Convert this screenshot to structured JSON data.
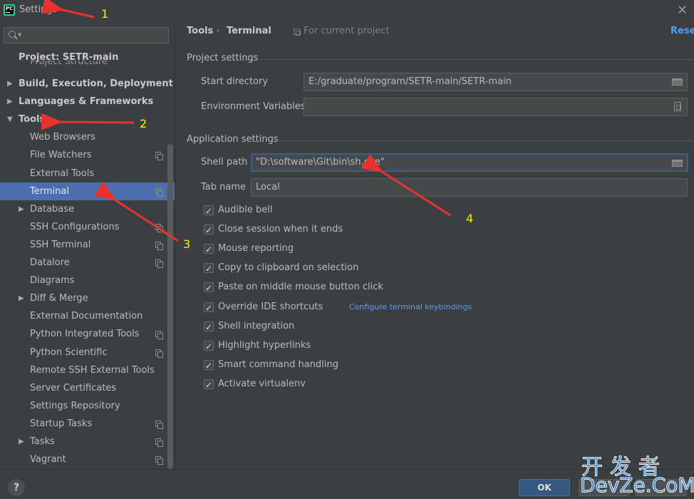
{
  "window": {
    "title": "Settings",
    "logo_text": "PC"
  },
  "sidebar": {
    "search_placeholder": "",
    "group_header": "Project: SETR-main",
    "clipped_item": "Project Structure",
    "items": [
      {
        "label": "Build, Execution, Deployment",
        "level": 0,
        "arrow": "▶",
        "bold": true,
        "project_scope": false
      },
      {
        "label": "Languages & Frameworks",
        "level": 0,
        "arrow": "▶",
        "bold": true,
        "project_scope": false
      },
      {
        "label": "Tools",
        "level": 0,
        "arrow": "▼",
        "bold": true,
        "project_scope": false
      },
      {
        "label": "Web Browsers",
        "level": 1,
        "arrow": "",
        "bold": false,
        "project_scope": false
      },
      {
        "label": "File Watchers",
        "level": 1,
        "arrow": "",
        "bold": false,
        "project_scope": true
      },
      {
        "label": "External Tools",
        "level": 1,
        "arrow": "",
        "bold": false,
        "project_scope": false
      },
      {
        "label": "Terminal",
        "level": 1,
        "arrow": "",
        "bold": false,
        "project_scope": true,
        "selected": true
      },
      {
        "label": "Database",
        "level": 1,
        "arrow": "▶",
        "bold": false,
        "project_scope": false
      },
      {
        "label": "SSH Configurations",
        "level": 1,
        "arrow": "",
        "bold": false,
        "project_scope": true
      },
      {
        "label": "SSH Terminal",
        "level": 1,
        "arrow": "",
        "bold": false,
        "project_scope": true
      },
      {
        "label": "Datalore",
        "level": 1,
        "arrow": "",
        "bold": false,
        "project_scope": true
      },
      {
        "label": "Diagrams",
        "level": 1,
        "arrow": "",
        "bold": false,
        "project_scope": false
      },
      {
        "label": "Diff & Merge",
        "level": 1,
        "arrow": "▶",
        "bold": false,
        "project_scope": false
      },
      {
        "label": "External Documentation",
        "level": 1,
        "arrow": "",
        "bold": false,
        "project_scope": false
      },
      {
        "label": "Python Integrated Tools",
        "level": 1,
        "arrow": "",
        "bold": false,
        "project_scope": true
      },
      {
        "label": "Python Scientific",
        "level": 1,
        "arrow": "",
        "bold": false,
        "project_scope": true
      },
      {
        "label": "Remote SSH External Tools",
        "level": 1,
        "arrow": "",
        "bold": false,
        "project_scope": false
      },
      {
        "label": "Server Certificates",
        "level": 1,
        "arrow": "",
        "bold": false,
        "project_scope": false
      },
      {
        "label": "Settings Repository",
        "level": 1,
        "arrow": "",
        "bold": false,
        "project_scope": false
      },
      {
        "label": "Startup Tasks",
        "level": 1,
        "arrow": "",
        "bold": false,
        "project_scope": true
      },
      {
        "label": "Tasks",
        "level": 1,
        "arrow": "▶",
        "bold": false,
        "project_scope": true
      },
      {
        "label": "Vagrant",
        "level": 1,
        "arrow": "",
        "bold": false,
        "project_scope": true
      }
    ]
  },
  "main": {
    "breadcrumb": {
      "parent": "Tools",
      "separator": "›",
      "current": "Terminal"
    },
    "scope_label": "For current project",
    "reset_label": "Reset",
    "project_settings": {
      "title": "Project settings",
      "start_directory_label": "Start directory",
      "start_directory_value": "E:/graduate/program/SETR-main/SETR-main",
      "env_vars_label": "Environment Variables",
      "env_vars_value": ""
    },
    "application_settings": {
      "title": "Application settings",
      "shell_path_label": "Shell path",
      "shell_path_value": "\"D:\\software\\Git\\bin\\sh.exe\"",
      "tab_name_label": "Tab name",
      "tab_name_value": "Local"
    },
    "checkboxes": [
      {
        "label": "Audible bell",
        "checked": true
      },
      {
        "label": "Close session when it ends",
        "checked": true
      },
      {
        "label": "Mouse reporting",
        "checked": true
      },
      {
        "label": "Copy to clipboard on selection",
        "checked": true
      },
      {
        "label": "Paste on middle mouse button click",
        "checked": true
      },
      {
        "label": "Override IDE shortcuts",
        "checked": true,
        "link": "Configure terminal keybindings"
      },
      {
        "label": "Shell integration",
        "checked": true
      },
      {
        "label": "Highlight hyperlinks",
        "checked": true
      },
      {
        "label": "Smart command handling",
        "checked": true
      },
      {
        "label": "Activate virtualenv",
        "checked": true
      }
    ]
  },
  "footer": {
    "help_label": "?",
    "ok_label": "OK",
    "cancel_label": "",
    "apply_label": ""
  },
  "watermark": {
    "cn": "开发者",
    "en": "DevZe.CoM"
  },
  "annotations": {
    "numbers": [
      "1",
      "2",
      "3",
      "4"
    ],
    "arrow_color": "#e8322d",
    "number_color": "#f5f500"
  },
  "colors": {
    "background": "#3c3f41",
    "selection": "#4b6eaf",
    "link": "#589df6",
    "ok_button": "#365880",
    "focus_border": "#3d6185"
  }
}
